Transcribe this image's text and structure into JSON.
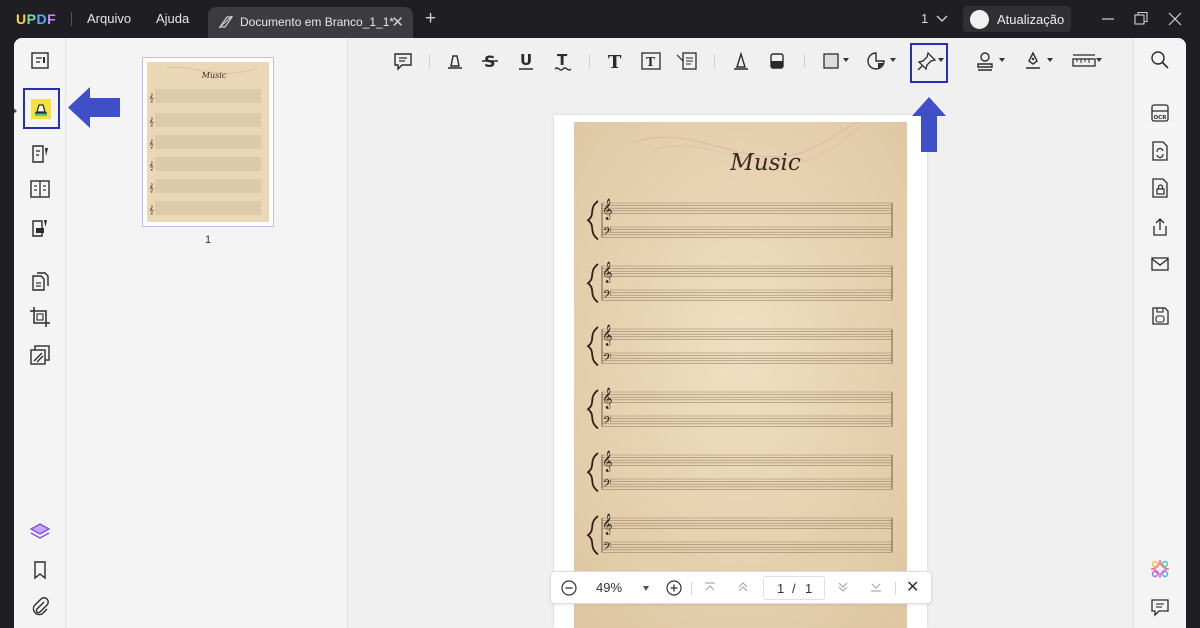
{
  "app": {
    "logo": "UPDF",
    "menu": [
      "Arquivo",
      "Ajuda"
    ],
    "tab_title": "Documento em Branco_1_1*",
    "tab_close": "✕",
    "new_tab": "+",
    "page_indicator": "1",
    "update_label": "Atualização"
  },
  "left_sidebar": {
    "items": [
      {
        "name": "reader-mode-icon",
        "active": false
      },
      {
        "name": "comment-mode-icon",
        "active": true
      },
      {
        "name": "edit-pdf-icon",
        "active": false
      },
      {
        "name": "form-icon",
        "active": false
      },
      {
        "name": "fill-sign-icon",
        "active": false
      },
      {
        "name": "organize-pages-icon",
        "active": false
      },
      {
        "name": "crop-icon",
        "active": false
      },
      {
        "name": "redact-icon",
        "active": false
      },
      {
        "name": "layers-icon",
        "active": false
      },
      {
        "name": "bookmark-icon",
        "active": false
      },
      {
        "name": "attachment-icon",
        "active": false
      }
    ]
  },
  "thumbnail": {
    "page_number": "1",
    "title": "Music"
  },
  "toolbar": {
    "tools": [
      "sticky-note",
      "highlighter",
      "strikethrough",
      "underline",
      "squiggly",
      "text",
      "text-box",
      "text-callout",
      "pencil",
      "eraser",
      "shape",
      "sticker",
      "pin",
      "stamp",
      "signature",
      "measure"
    ],
    "selected": "pin"
  },
  "document": {
    "title": "Music",
    "staff_systems": 6,
    "background": "#e9d6b4"
  },
  "zoom": {
    "minus": "−",
    "value": "49%",
    "plus": "+",
    "current_page": "1",
    "separator": "/",
    "total_pages": "1",
    "close": "✕"
  },
  "colors": {
    "accent_highlight": "#2431b3",
    "arrow": "#3f4fc8",
    "highlighter_yellow": "#f5e13a"
  }
}
